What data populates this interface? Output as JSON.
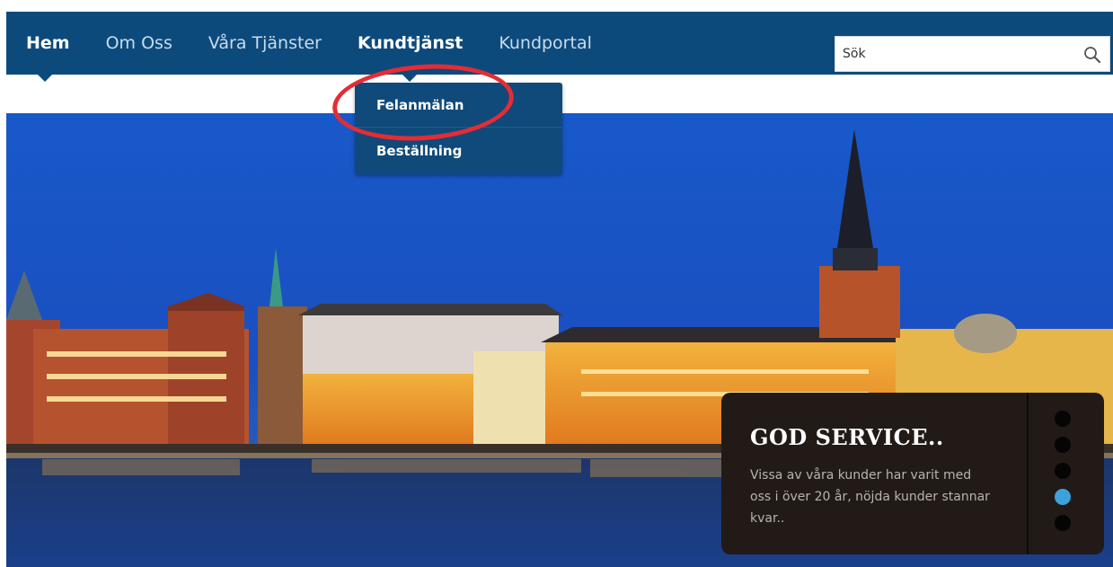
{
  "nav": {
    "items": [
      {
        "label": "Hem"
      },
      {
        "label": "Om Oss"
      },
      {
        "label": "Våra Tjänster"
      },
      {
        "label": "Kundtjänst"
      },
      {
        "label": "Kundportal"
      }
    ]
  },
  "search": {
    "placeholder": "Sök"
  },
  "dropdown": {
    "items": [
      {
        "label": "Felanmälan"
      },
      {
        "label": "Beställning"
      }
    ]
  },
  "hero_panel": {
    "title": "GOD SERVICE..",
    "text": "Vissa av våra kunder har varit med oss i över 20 år, nöjda kunder stannar kvar..",
    "active_slide": 4,
    "slide_count": 5
  },
  "colors": {
    "nav_bg": "#0d4a7c",
    "dropdown_bg": "#0f4a7a",
    "panel_bg": "#211a17",
    "active_dot": "#3da2dc",
    "highlight": "#e52c34"
  }
}
